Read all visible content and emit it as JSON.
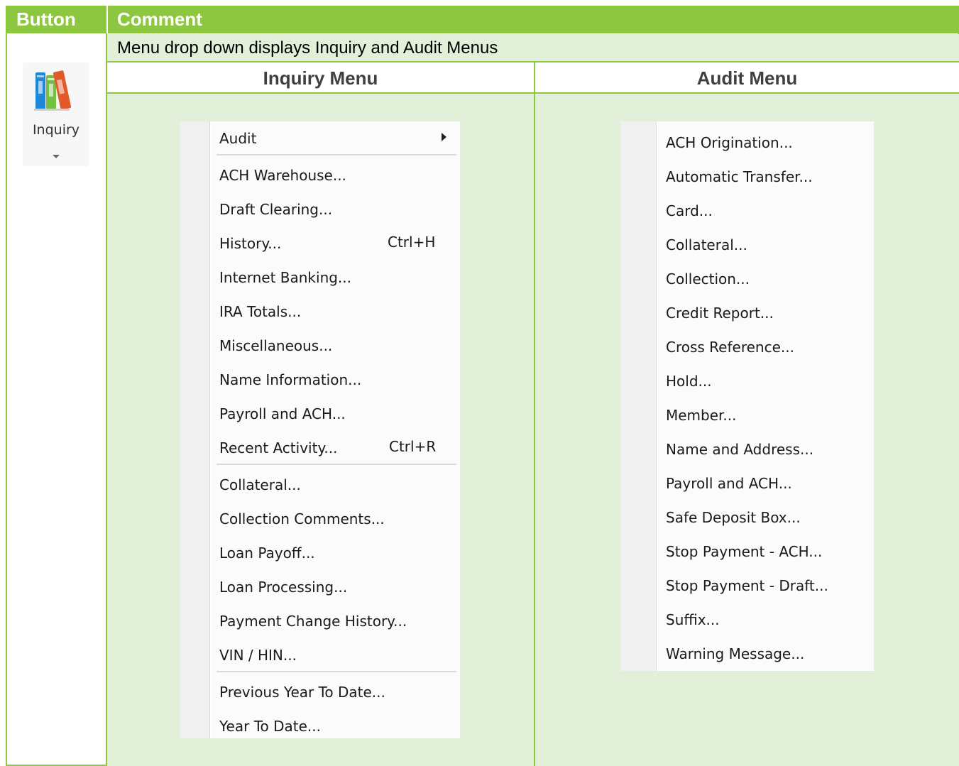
{
  "header": {
    "button_col": "Button",
    "comment_col": "Comment"
  },
  "comment_text": "Menu drop down displays Inquiry and Audit Menus",
  "inquiry_button": {
    "label": "Inquiry",
    "icon": "books-icon"
  },
  "inquiry_menu": {
    "title": "Inquiry Menu",
    "items": [
      {
        "label": "Audit",
        "shortcut": ""
      },
      {
        "label": "ACH Warehouse...",
        "shortcut": ""
      },
      {
        "label": "Draft Clearing...",
        "shortcut": ""
      },
      {
        "label": "History...",
        "shortcut": "Ctrl+H"
      },
      {
        "label": "Internet Banking...",
        "shortcut": ""
      },
      {
        "label": "IRA Totals...",
        "shortcut": ""
      },
      {
        "label": "Miscellaneous...",
        "shortcut": ""
      },
      {
        "label": "Name Information...",
        "shortcut": ""
      },
      {
        "label": "Payroll and ACH...",
        "shortcut": ""
      },
      {
        "label": "Recent Activity...",
        "shortcut": "Ctrl+R"
      },
      {
        "label": "Collateral...",
        "shortcut": ""
      },
      {
        "label": "Collection Comments...",
        "shortcut": ""
      },
      {
        "label": "Loan Payoff...",
        "shortcut": ""
      },
      {
        "label": "Loan Processing...",
        "shortcut": ""
      },
      {
        "label": "Payment Change History...",
        "shortcut": ""
      },
      {
        "label": "VIN / HIN...",
        "shortcut": ""
      },
      {
        "label": "Previous Year To Date...",
        "shortcut": ""
      },
      {
        "label": "Year To Date...",
        "shortcut": ""
      }
    ]
  },
  "audit_menu": {
    "title": "Audit Menu",
    "items": [
      "ACH Origination...",
      "Automatic Transfer...",
      "Card...",
      "Collateral...",
      "Collection...",
      "Credit Report...",
      "Cross Reference...",
      "Hold...",
      "Member...",
      "Name and Address...",
      "Payroll and ACH...",
      "Safe Deposit Box...",
      "Stop Payment - ACH...",
      "Stop Payment - Draft...",
      "Suffix...",
      "Warning Message..."
    ]
  },
  "colors": {
    "header_green": "#8dc63f",
    "cell_green": "#e2efd9"
  }
}
